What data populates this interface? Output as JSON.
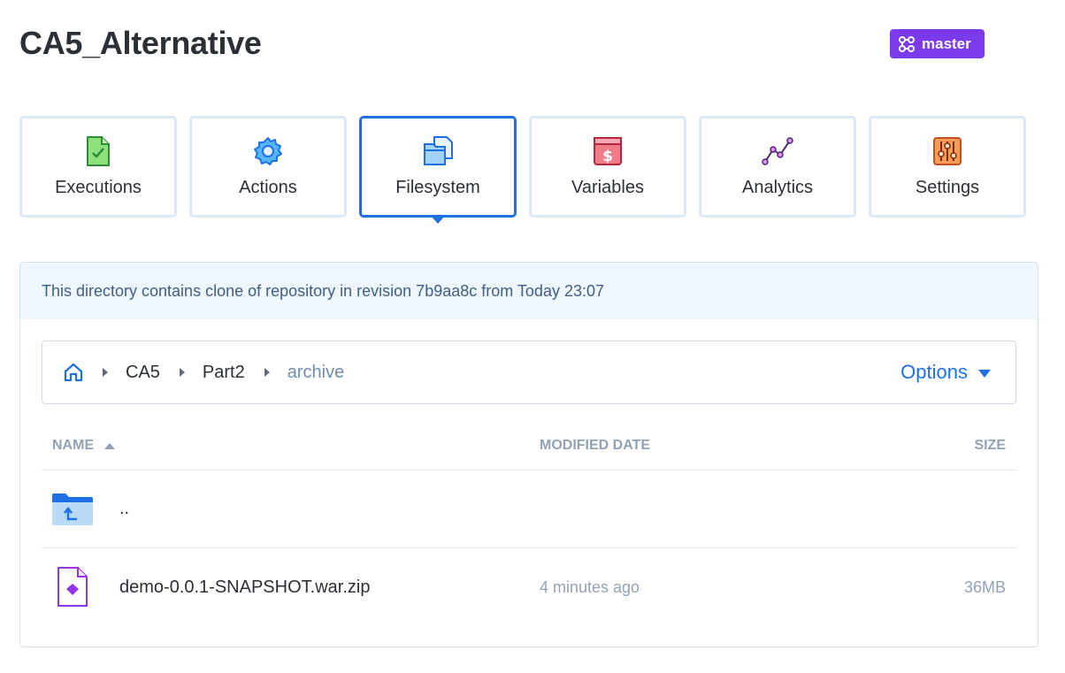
{
  "header": {
    "title": "CA5_Alternative",
    "branch": "master"
  },
  "tabs": [
    {
      "label": "Executions",
      "icon": "document-check-icon"
    },
    {
      "label": "Actions",
      "icon": "gear-icon"
    },
    {
      "label": "Filesystem",
      "icon": "files-icon",
      "active": true
    },
    {
      "label": "Variables",
      "icon": "dollar-box-icon"
    },
    {
      "label": "Analytics",
      "icon": "line-chart-icon"
    },
    {
      "label": "Settings",
      "icon": "sliders-icon"
    }
  ],
  "info": {
    "message": "This directory contains clone of repository in revision 7b9aa8c from Today 23:07"
  },
  "breadcrumb": {
    "home_icon": "home-icon",
    "items": [
      "CA5",
      "Part2",
      "archive"
    ],
    "options_label": "Options"
  },
  "table": {
    "columns": {
      "name": "NAME",
      "modified": "MODIFIED DATE",
      "size": "SIZE"
    },
    "rows": [
      {
        "name": "..",
        "modified": "",
        "size": "",
        "icon": "folder-up-icon"
      },
      {
        "name": "demo-0.0.1-SNAPSHOT.war.zip",
        "modified": "4 minutes ago",
        "size": "36MB",
        "icon": "archive-file-icon"
      }
    ]
  },
  "colors": {
    "accent": "#1f6fe5",
    "branch_badge": "#7c3aed",
    "info_background": "#eef6fc"
  }
}
